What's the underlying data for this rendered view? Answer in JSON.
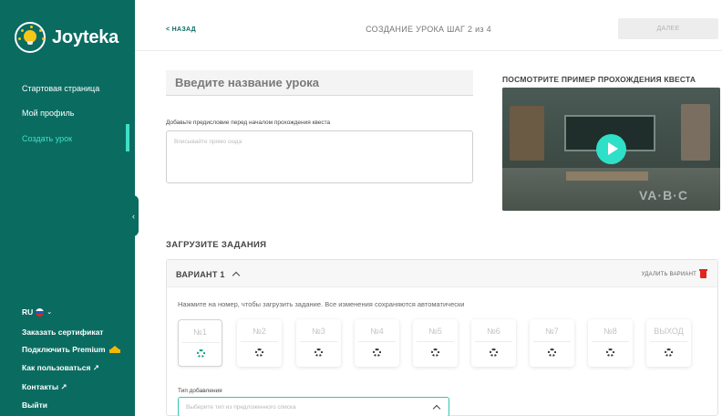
{
  "app": {
    "name": "Joyteka"
  },
  "sidebar": {
    "items": [
      {
        "label": "Стартовая страница"
      },
      {
        "label": "Мой профиль"
      },
      {
        "label": "Создать урок"
      }
    ],
    "bottom": {
      "language": "RU",
      "certificate": "Заказать сертификат",
      "premium": "Подключить Premium",
      "how_to": "Как пользоваться ↗",
      "contacts": "Контакты ↗",
      "logout": "Выйти"
    },
    "accent_color": "#3ee0c8",
    "background_color": "#0a6b61"
  },
  "header": {
    "back": "< НАЗАД",
    "step_title": "СОЗДАНИЕ УРОКА ШАГ 2 из 4",
    "next": "ДАЛЕЕ"
  },
  "form": {
    "title_placeholder": "Введите название урока",
    "preface_label": "Добавьте предисловие перед началом прохождения квеста",
    "preface_placeholder": "Вписывайте прямо сюда"
  },
  "example": {
    "title": "ПОСМОТРИТЕ ПРИМЕР ПРОХОЖДЕНИЯ КВЕСТА",
    "floor_text": "VA·B·C"
  },
  "tasks": {
    "section_title": "ЗАГРУЗИТЕ ЗАДАНИЯ",
    "variant": {
      "title": "ВАРИАНТ 1",
      "delete": "УДАЛИТЬ ВАРИАНТ",
      "hint": "Нажмите на номер, чтобы загрузить задание. Все изменения сохраняются автоматически",
      "slots": [
        {
          "label": "№1"
        },
        {
          "label": "№2"
        },
        {
          "label": "№3"
        },
        {
          "label": "№4"
        },
        {
          "label": "№5"
        },
        {
          "label": "№6"
        },
        {
          "label": "№7"
        },
        {
          "label": "№8"
        },
        {
          "label": "ВЫХОД"
        }
      ],
      "add_type_label": "Тип добавления",
      "add_type_placeholder": "Выберите тип из предложенного списка"
    }
  }
}
